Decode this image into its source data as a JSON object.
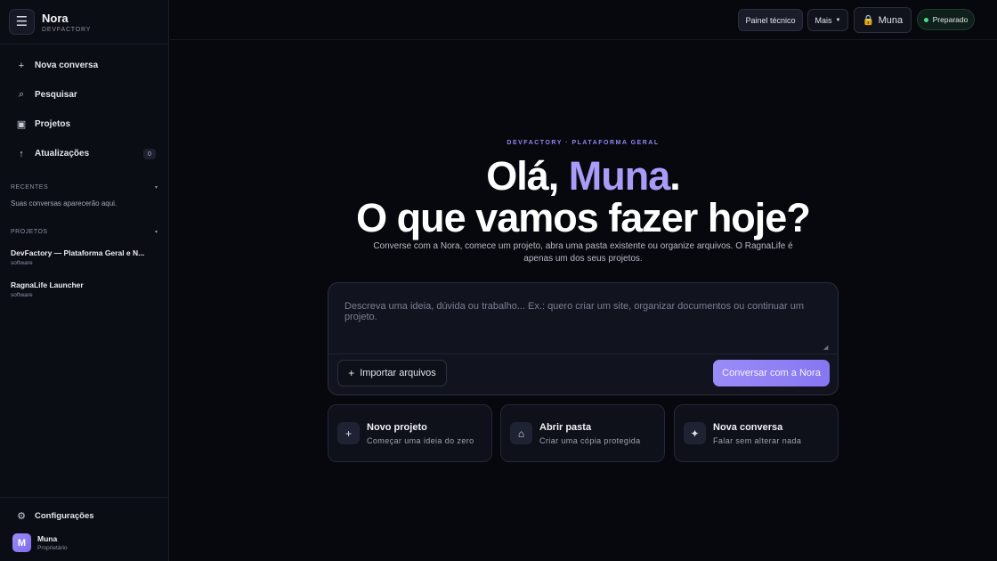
{
  "sidebar": {
    "brand": {
      "name": "Nora",
      "sub": "DEVFACTORY"
    },
    "nav": [
      {
        "icon": "plus-icon",
        "label": "Nova conversa"
      },
      {
        "icon": "search-icon",
        "label": "Pesquisar"
      },
      {
        "icon": "folder-icon",
        "label": "Projetos"
      },
      {
        "icon": "arrow-up-icon",
        "label": "Atualizações",
        "badge": "0"
      }
    ],
    "recent": {
      "title": "RECENTES",
      "empty": "Suas conversas aparecerão aqui."
    },
    "projects": {
      "title": "PROJETOS",
      "items": [
        {
          "name": "DevFactory — Plataforma Geral e N...",
          "type": "software"
        },
        {
          "name": "RagnaLife Launcher",
          "type": "software"
        }
      ]
    },
    "settings": "Configurações",
    "user": {
      "initial": "M",
      "name": "Muna",
      "role": "Proprietário"
    }
  },
  "topbar": {
    "painel": "Painel técnico",
    "mais": "Mais",
    "user": "Muna",
    "status": "Preparado"
  },
  "hero": {
    "kicker": "DEVFACTORY · PLATAFORMA GERAL",
    "greeting_prefix": "Olá, ",
    "greeting_name": "Muna",
    "greeting_suffix": ".",
    "question": "O que vamos fazer hoje?",
    "lead": "Converse com a Nora, comece um projeto, abra uma pasta existente ou organize arquivos. O RagnaLife é apenas um dos seus projetos."
  },
  "composer": {
    "placeholder": "Descreva uma ideia, dúvida ou trabalho... Ex.: quero criar um site, organizar documentos ou continuar um projeto.",
    "value": "",
    "import_label": "Importar arquivos",
    "send_label": "Conversar com a Nora"
  },
  "cards": [
    {
      "icon": "plus-icon",
      "title": "Novo projeto",
      "subtitle": "Começar uma ideia do zero"
    },
    {
      "icon": "home-icon",
      "title": "Abrir pasta",
      "subtitle": "Criar uma cópia protegida"
    },
    {
      "icon": "sparkle-icon",
      "title": "Nova conversa",
      "subtitle": "Falar sem alterar nada"
    }
  ],
  "colors": {
    "accent": "#9a8cf7",
    "background": "#07080d",
    "status": "#4ade80"
  }
}
